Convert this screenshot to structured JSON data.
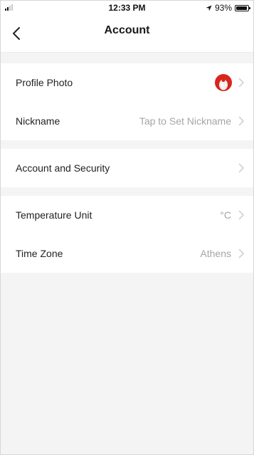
{
  "status_bar": {
    "time": "12:33 PM",
    "battery_percent": "93%",
    "battery_level": 0.93,
    "signal_bars_active": 2,
    "location_icon": "location-arrow-icon"
  },
  "nav": {
    "title": "Account",
    "back_icon": "chevron-left-icon"
  },
  "sections": [
    {
      "rows": [
        {
          "label": "Profile Photo",
          "value": "",
          "icon": "avatar-icon"
        },
        {
          "label": "Nickname",
          "value": "Tap to Set Nickname"
        }
      ]
    },
    {
      "rows": [
        {
          "label": "Account and Security",
          "value": ""
        }
      ]
    },
    {
      "rows": [
        {
          "label": "Temperature Unit",
          "value": "°C"
        },
        {
          "label": "Time Zone",
          "value": "Athens"
        }
      ]
    }
  ],
  "colors": {
    "background": "#f4f4f4",
    "row_background": "#ffffff",
    "secondary_text": "#a5a5a5",
    "avatar_red": "#e02020"
  }
}
